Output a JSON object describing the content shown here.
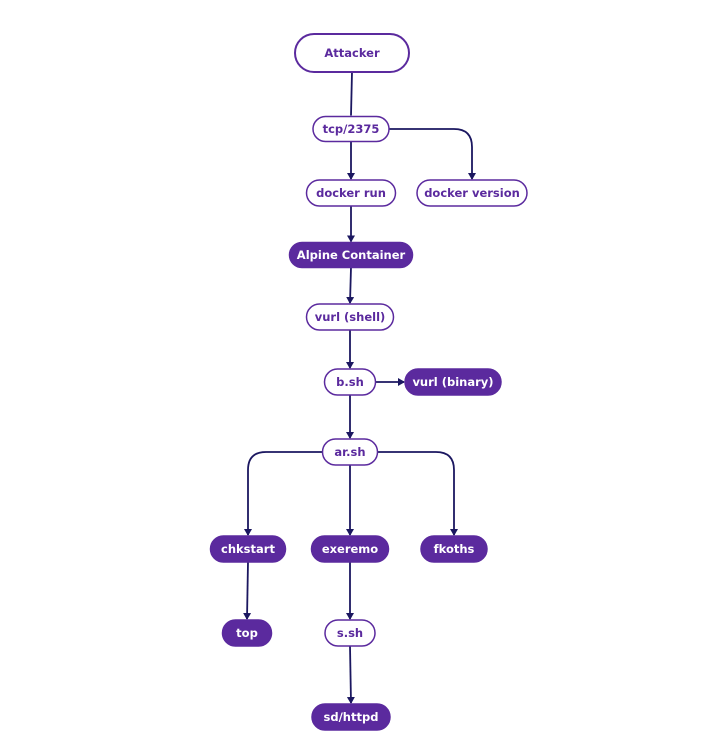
{
  "colors": {
    "accent": "#5b2a9e",
    "edge": "#1b1760",
    "background": "#ffffff"
  },
  "nodes": [
    {
      "id": "attacker",
      "label": "Attacker",
      "style": "outline"
    },
    {
      "id": "tcp",
      "label": "tcp/2375",
      "style": "outline"
    },
    {
      "id": "docker-run",
      "label": "docker run",
      "style": "outline"
    },
    {
      "id": "docker-version",
      "label": "docker version",
      "style": "outline"
    },
    {
      "id": "alpine",
      "label": "Alpine Container",
      "style": "filled"
    },
    {
      "id": "vurl-shell",
      "label": "vurl (shell)",
      "style": "outline"
    },
    {
      "id": "bsh",
      "label": "b.sh",
      "style": "outline"
    },
    {
      "id": "vurl-binary",
      "label": "vurl (binary)",
      "style": "filled"
    },
    {
      "id": "arsh",
      "label": "ar.sh",
      "style": "outline"
    },
    {
      "id": "chkstart",
      "label": "chkstart",
      "style": "filled"
    },
    {
      "id": "exeremo",
      "label": "exeremo",
      "style": "filled"
    },
    {
      "id": "fkoths",
      "label": "fkoths",
      "style": "filled"
    },
    {
      "id": "top",
      "label": "top",
      "style": "filled"
    },
    {
      "id": "ssh",
      "label": "s.sh",
      "style": "outline"
    },
    {
      "id": "sdhttpd",
      "label": "sd/httpd",
      "style": "filled"
    }
  ],
  "edges": [
    {
      "from": "attacker",
      "to": "tcp",
      "arrow": false
    },
    {
      "from": "tcp",
      "to": "docker-run",
      "arrow": true
    },
    {
      "from": "tcp",
      "to": "docker-version",
      "arrow": true
    },
    {
      "from": "docker-run",
      "to": "alpine",
      "arrow": true
    },
    {
      "from": "alpine",
      "to": "vurl-shell",
      "arrow": true
    },
    {
      "from": "vurl-shell",
      "to": "bsh",
      "arrow": true
    },
    {
      "from": "bsh",
      "to": "vurl-binary",
      "arrow": true
    },
    {
      "from": "bsh",
      "to": "arsh",
      "arrow": true
    },
    {
      "from": "arsh",
      "to": "chkstart",
      "arrow": true
    },
    {
      "from": "arsh",
      "to": "exeremo",
      "arrow": true
    },
    {
      "from": "arsh",
      "to": "fkoths",
      "arrow": true
    },
    {
      "from": "chkstart",
      "to": "top",
      "arrow": true
    },
    {
      "from": "exeremo",
      "to": "ssh",
      "arrow": true
    },
    {
      "from": "ssh",
      "to": "sdhttpd",
      "arrow": true
    }
  ]
}
